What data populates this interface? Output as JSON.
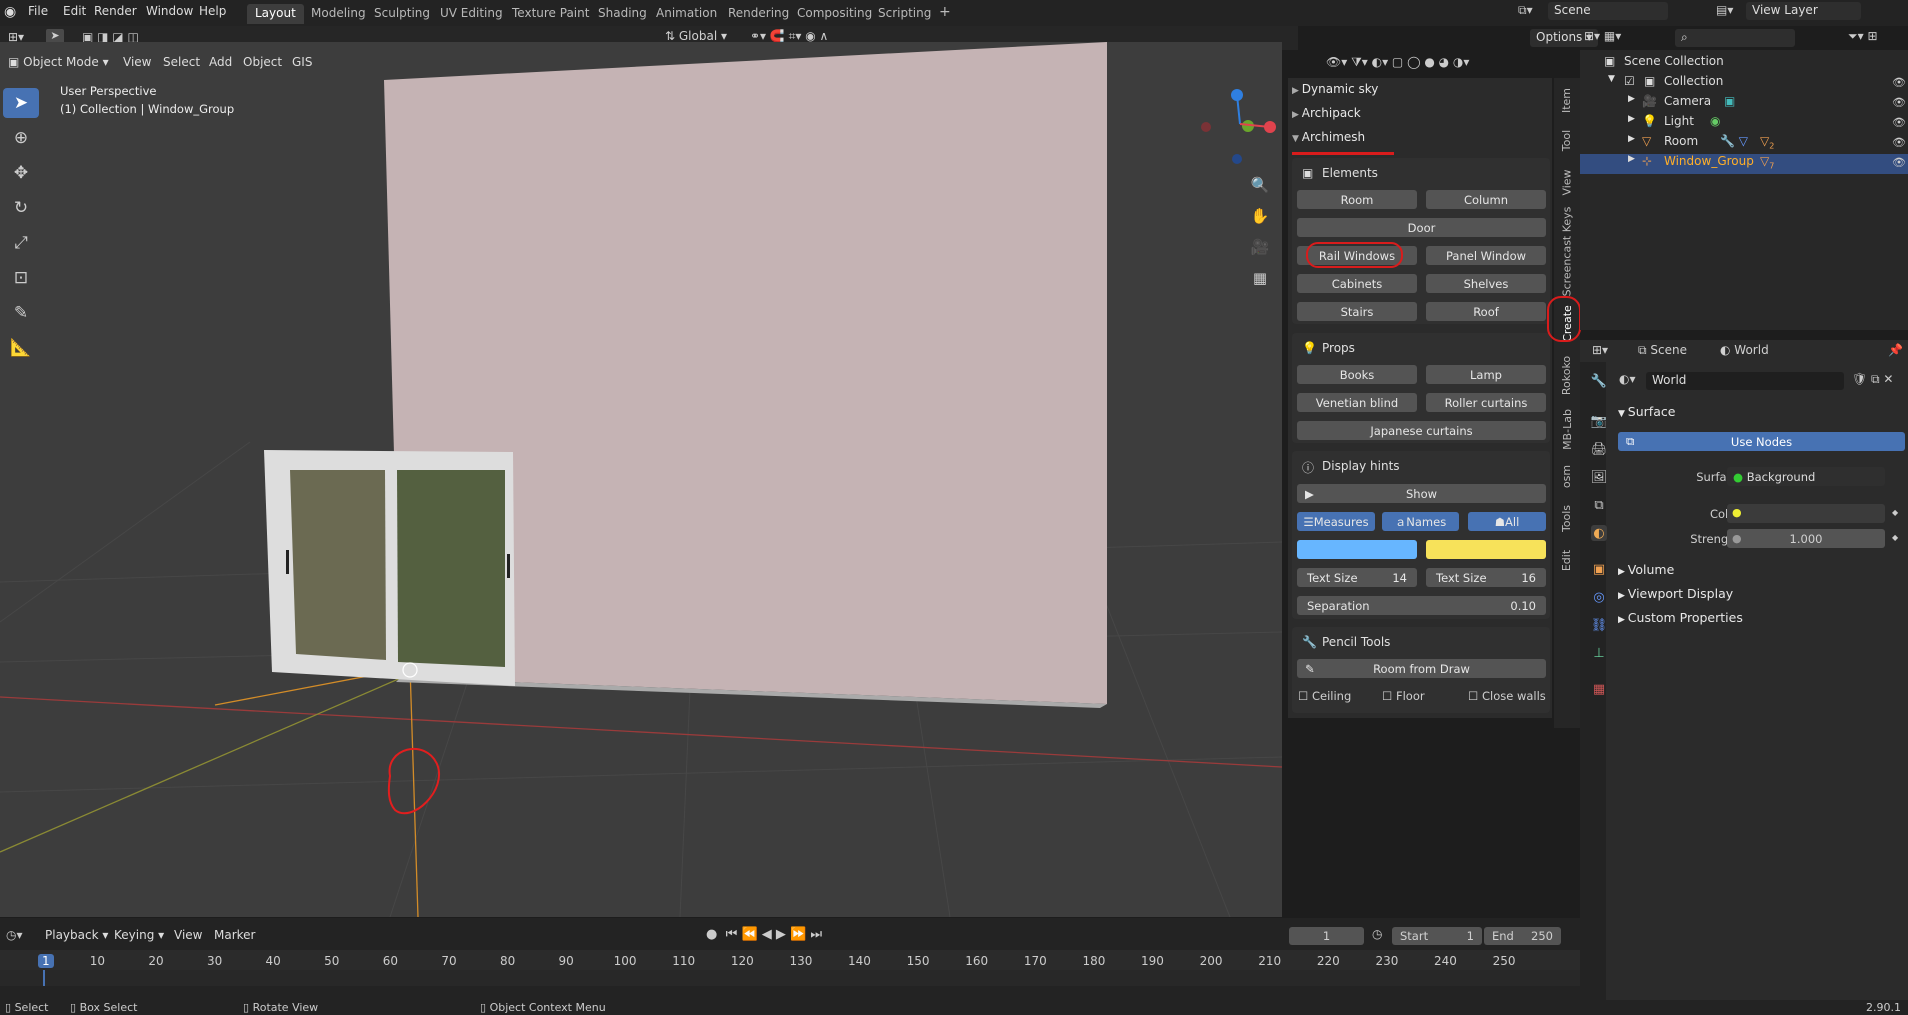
{
  "menu": [
    "File",
    "Edit",
    "Render",
    "Window",
    "Help"
  ],
  "workspaces": [
    "Layout",
    "Modeling",
    "Sculpting",
    "UV Editing",
    "Texture Paint",
    "Shading",
    "Animation",
    "Rendering",
    "Compositing",
    "Scripting"
  ],
  "scene": "Scene",
  "view_layer": "View Layer",
  "header": {
    "mode": "Object Mode",
    "view": "View",
    "select": "Select",
    "add": "Add",
    "object": "Object",
    "gis": "GIS",
    "transform": "Global",
    "options": "Options"
  },
  "viewport": {
    "persp": "User Perspective",
    "collection": "(1) Collection | Window_Group"
  },
  "npanel": {
    "collapsed": [
      "Dynamic sky",
      "Archipack"
    ],
    "open": "Archimesh",
    "elements": {
      "title": "Elements",
      "buttons": [
        "Room",
        "Column",
        "Door",
        "Rail Windows",
        "Panel Window",
        "Cabinets",
        "Shelves",
        "Stairs",
        "Roof"
      ]
    },
    "props": {
      "title": "Props",
      "buttons": [
        "Books",
        "Lamp",
        "Venetian blind",
        "Roller curtains",
        "Japanese curtains"
      ]
    },
    "hints": {
      "title": "Display hints",
      "show": "Show",
      "measures": "Measures",
      "names": "Names",
      "all": "All",
      "text_size_label": "Text Size",
      "text_size_1": "14",
      "text_size_2": "16",
      "separation_label": "Separation",
      "separation": "0.10",
      "color_left": "#67b6ff",
      "color_right": "#f7e25a"
    },
    "pencil": {
      "title": "Pencil Tools",
      "room_from_draw": "Room from Draw",
      "ceiling": "Ceiling",
      "floor": "Floor",
      "close_walls": "Close walls"
    },
    "tabs": [
      "Item",
      "Tool",
      "View",
      "Screencast Keys",
      "Create",
      "Rokoko",
      "MB-Lab",
      "osm",
      "Tools",
      "Edit"
    ]
  },
  "outliner": {
    "root": "Scene Collection",
    "collection": "Collection",
    "items": [
      "Camera",
      "Light",
      "Room",
      "Window_Group"
    ],
    "counts": [
      "2",
      "7"
    ]
  },
  "props": {
    "scene": "Scene",
    "world": "World",
    "world_field": "World",
    "surface": "Surface",
    "use_nodes": "Use Nodes",
    "surface_label": "Surface",
    "background": "Background",
    "color": "Color",
    "strength": "Strength",
    "strength_value": "1.000",
    "volume": "Volume",
    "viewport_display": "Viewport Display",
    "custom": "Custom Properties"
  },
  "timeline": {
    "playback": "Playback",
    "keying": "Keying",
    "view": "View",
    "marker": "Marker",
    "frame": "1",
    "start_label": "Start",
    "start": "1",
    "end_label": "End",
    "end": "250",
    "ticks": [
      "1",
      "10",
      "20",
      "30",
      "40",
      "50",
      "60",
      "70",
      "80",
      "90",
      "100",
      "110",
      "120",
      "130",
      "140",
      "150",
      "160",
      "170",
      "180",
      "190",
      "200",
      "210",
      "220",
      "230",
      "240",
      "250"
    ]
  },
  "status": {
    "select": "Select",
    "box": "Box Select",
    "rotate": "Rotate View",
    "context": "Object Context Menu",
    "version": "2.90.1"
  }
}
